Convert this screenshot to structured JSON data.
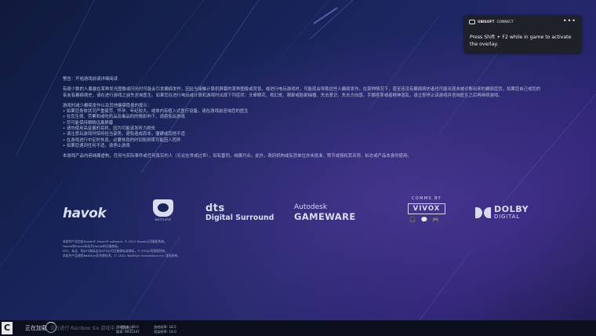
{
  "warning": {
    "heading": "警告：开始游戏前请详细阅读",
    "para1": "有极少数的人暴露在某种发光图像或闪光时可能会引发癫痫发作，因此当接触计算机屏幕的某种图像或背景，或进行电玩游戏时，可能就会导致这些人癫痫发作。在某种情况下，甚至连没有癫痫病史者也可能出现未被诊断出来的癫痫症状。如果您自己或您的亲友有癫痫病史，请在进行游戏之前先咨询医生。如果您在进行电玩或计算机游戏时出现下列症状：头晕眼花、视幻觉、眼部或脸部抽播、失去意识、失去方向感、手脚痉挛或者精神混乱，请立即停止该游戏并咨询医生之后再继续游戏。",
    "list_intro": "游戏时减少癫痫发作以及其他健康隐患的提示：",
    "items": [
      "• 如果您身体状况严重疲劳、怀孕、年纪较大，或体内有植入式医疗设备，请在游戏前咨询您的医生",
      "• 在您生病、劳累和或吃药品及毒品的的情影响下，请避免玩游戏",
      "• 尽可能保持眼睛远离屏幕",
      "• 请勿使用高音量的耳机，因为可能该发听力损失",
      "• 请注意玩游戏时保持恰当姿势，避免造成肩本，僵硬或其他不适",
      "• 在游戏进行中定时休息，必要休息的时间和频率可能因人而异",
      "• 如果您遇到任何不适，请停止游戏"
    ],
    "para3": "本游戏产品内容纯属虚构，任何与实际事件或任何真实的人（无论在世或过世），如有雷同，纯属巧合。此外，政府机构或反恐单位亦未批准、赞节或授权其名称、标志或产品本身的使用。"
  },
  "logos": {
    "havok": "havok",
    "battleye": "BATTLEYE",
    "dts_line1": "dts",
    "dts_line2": "Digital Surround",
    "autodesk_line1": "Autodesk",
    "autodesk_line2": "GAMEWARE",
    "vivox_line1": "COMMS BY",
    "vivox_line2": "VIVOX",
    "vivox_icons": "🎧💬🎮",
    "dolby_line1": "DOLBY",
    "dolby_line2": "DIGITAL"
  },
  "legal": [
    "本软件产品包含Havok® Vision® software. © 2012 Havok公司版权所有。",
    "Havok和Havok标志为Havok的注册商标。",
    "DTS、标志、和DTS和标志为DTS公司注册商标或商标，© DTS公司版权所有。",
    "本软件产品使用BattlEye反作弊技术。© 2020. BattlEye Innovations e.K. 版权所有。"
  ],
  "notification": {
    "brand_bold": "UBISOFT",
    "brand": "CONNECT",
    "more": "•••",
    "message": "Press Shift + F2 while in game to activate the overlay."
  },
  "bottom_bar": {
    "badge": "C",
    "loading": "正在加载",
    "faint_text": "正在进行 Rainbow Six 游戏中，请稍后",
    "stats": [
      "游戏版本: 29.0",
      "版本: 6935347",
      "游戏帧率: 18.5",
      "渲染帧率: 16.0"
    ]
  }
}
